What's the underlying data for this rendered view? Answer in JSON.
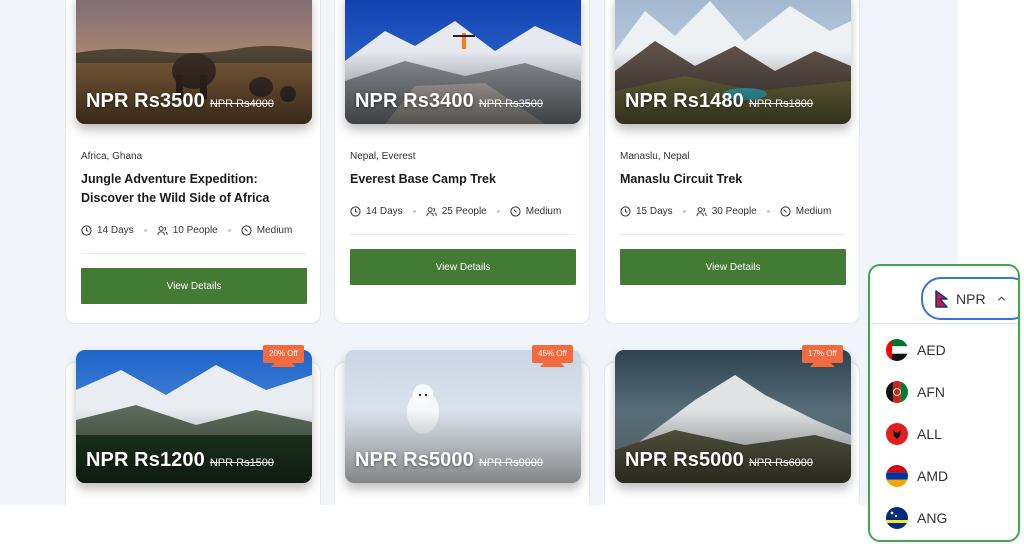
{
  "cards": [
    {
      "location": "Africa, Ghana",
      "title": "Jungle Adventure Expedition: Discover the Wild Side of Africa",
      "price": "NPR Rs3500",
      "old_price": "NPR Rs4000",
      "discount": "",
      "days": "14 Days",
      "people": "10 People",
      "difficulty": "Medium",
      "button": "View Details"
    },
    {
      "location": "Nepal, Everest",
      "title": "Everest Base Camp Trek",
      "price": "NPR Rs3400",
      "old_price": "NPR Rs3500",
      "discount": "",
      "days": "14 Days",
      "people": "25 People",
      "difficulty": "Medium",
      "button": "View Details"
    },
    {
      "location": "Manaslu, Nepal",
      "title": "Manaslu Circuit Trek",
      "price": "NPR Rs1480",
      "old_price": "NPR Rs1800",
      "discount": "",
      "days": "15 Days",
      "people": "30 People",
      "difficulty": "Medium",
      "button": "View Details"
    },
    {
      "price": "NPR Rs1200",
      "old_price": "NPR Rs1500",
      "discount": "20% Off"
    },
    {
      "price": "NPR Rs5000",
      "old_price": "NPR Rs9000",
      "discount": "45% Off"
    },
    {
      "price": "NPR Rs5000",
      "old_price": "NPR Rs6000",
      "discount": "17% Off"
    }
  ],
  "currency": {
    "selected": "NPR",
    "options": [
      {
        "code": "AED",
        "flag": "uae-flag-icon"
      },
      {
        "code": "AFN",
        "flag": "afghanistan-flag-icon"
      },
      {
        "code": "ALL",
        "flag": "albania-flag-icon"
      },
      {
        "code": "AMD",
        "flag": "armenia-flag-icon"
      },
      {
        "code": "ANG",
        "flag": "curacao-flag-icon"
      }
    ]
  }
}
